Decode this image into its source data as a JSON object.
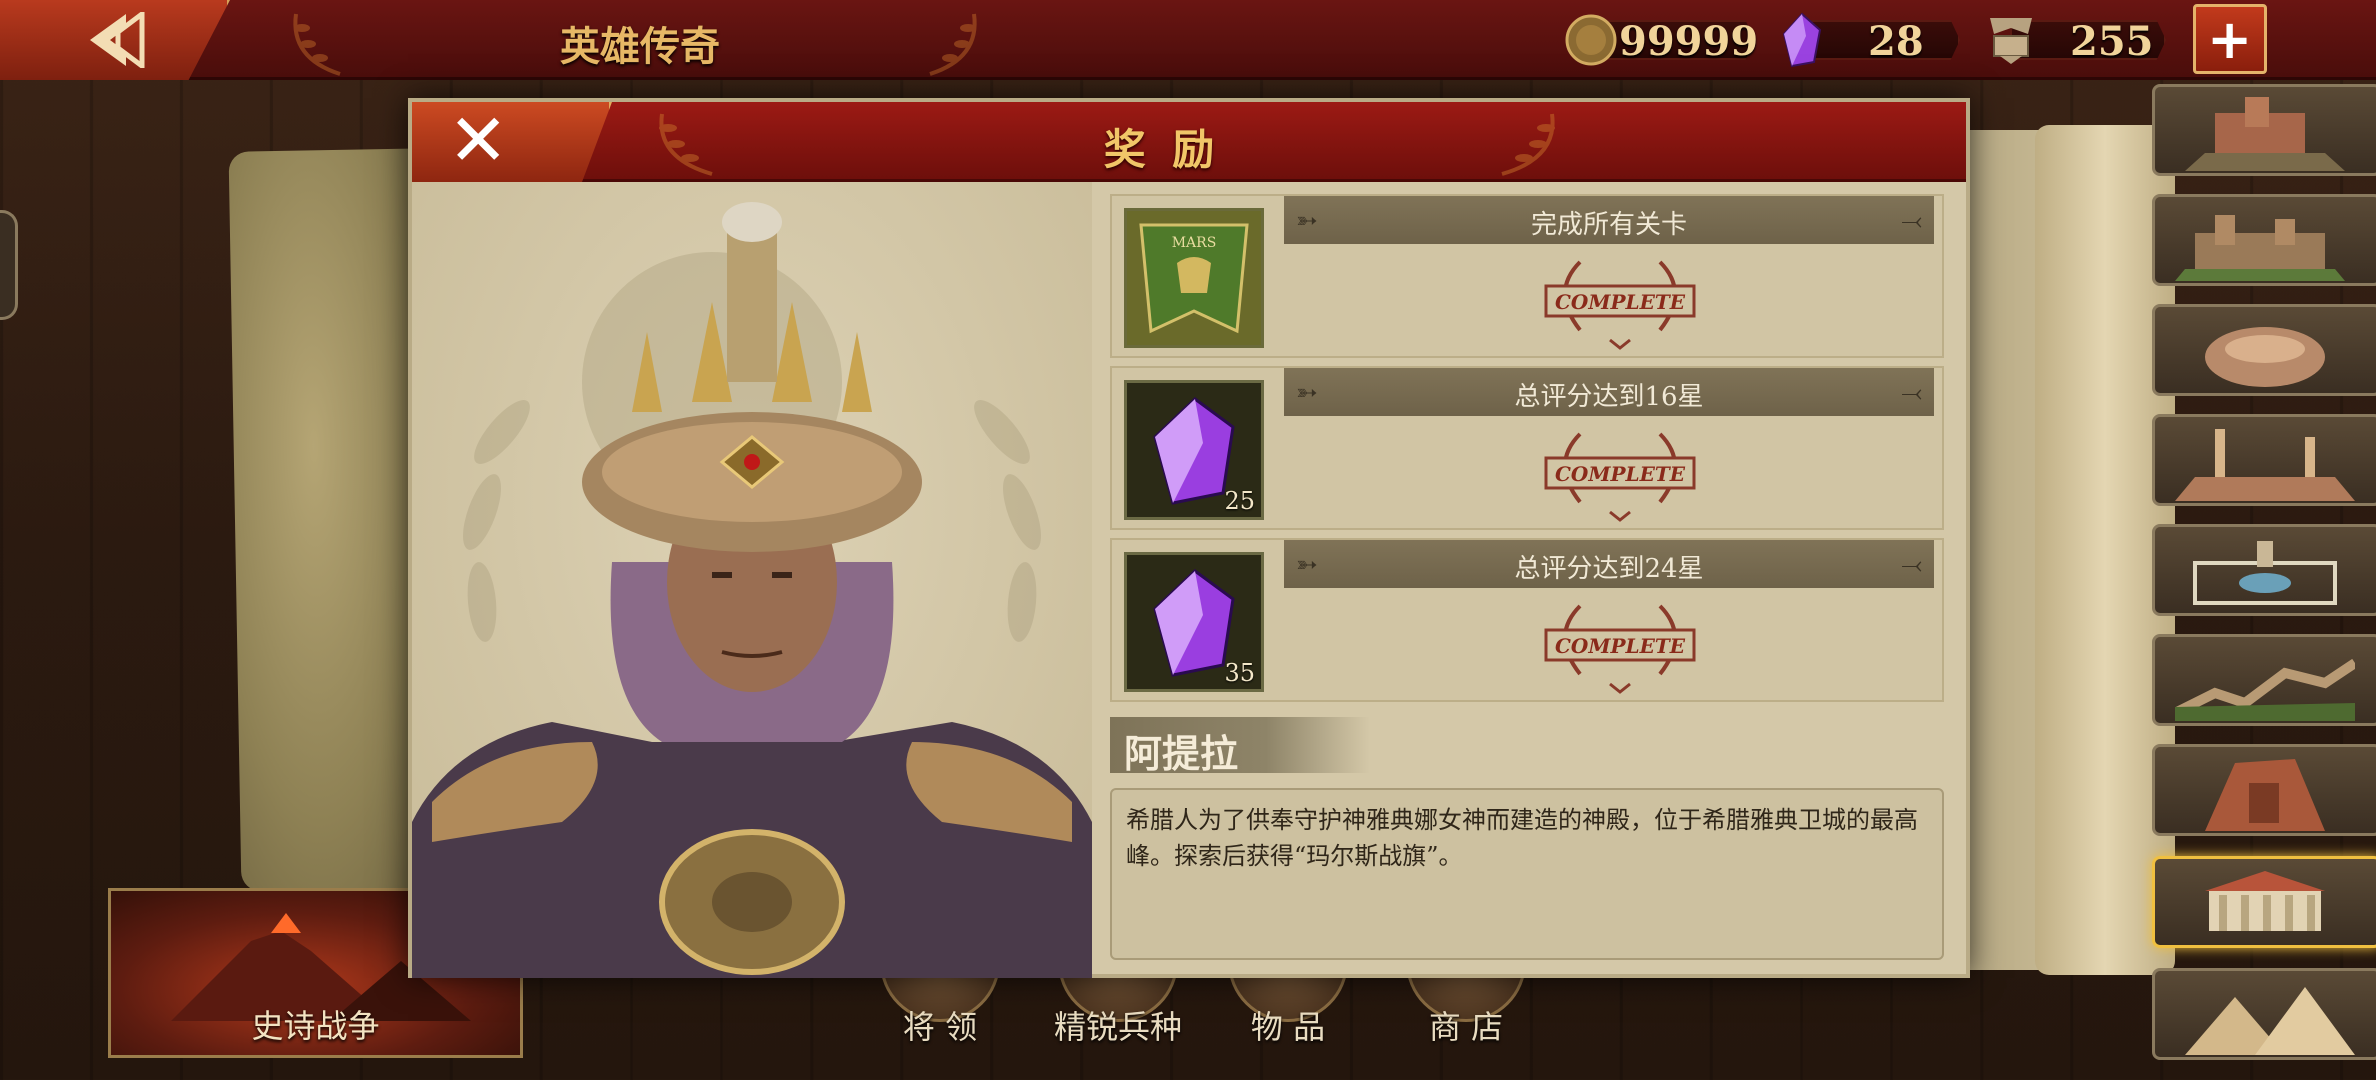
{
  "topbar": {
    "title": "英雄传奇",
    "gold": "99999",
    "gems": "28",
    "honor": "255"
  },
  "modal": {
    "title": "奖 励",
    "hero_name": "阿提拉",
    "description": "希腊人为了供奉守护神雅典娜女神而建造的神殿，位于希腊雅典卫城的最高峰。探索后获得“玛尔斯战旗”。",
    "rewards": [
      {
        "condition": "完成所有关卡",
        "icon": "mars-banner-icon",
        "qty": "",
        "status": "COMPLETE"
      },
      {
        "condition": "总评分达到16星",
        "icon": "purple-gem-icon",
        "qty": "25",
        "status": "COMPLETE"
      },
      {
        "condition": "总评分达到24星",
        "icon": "purple-gem-icon",
        "qty": "35",
        "status": "COMPLETE"
      }
    ],
    "banner_text": "MARS"
  },
  "left": {
    "epic_war": "史诗战争"
  },
  "bottom_nav": [
    {
      "label": "将 领"
    },
    {
      "label": "精锐兵种"
    },
    {
      "label": "物 品"
    },
    {
      "label": "商 店"
    }
  ],
  "stages_selected_index": 7,
  "colors": {
    "top_bar": "#5a1110",
    "accent_gold": "#e7b866",
    "panel_bg": "#d4c8a8",
    "complete_red": "#8a2a1a"
  }
}
